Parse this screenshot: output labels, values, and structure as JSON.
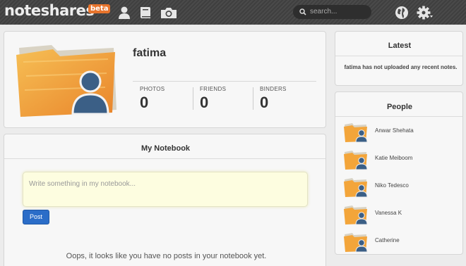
{
  "header": {
    "logo_text": "noteshares",
    "beta_label": "beta",
    "search_placeholder": "search...",
    "icons": [
      "user-icon",
      "book-icon",
      "camera-icon",
      "globe-icon",
      "gear-icon"
    ]
  },
  "profile": {
    "username": "fatima",
    "stats": [
      {
        "label": "PHOTOS",
        "value": "0"
      },
      {
        "label": "FRIENDS",
        "value": "0"
      },
      {
        "label": "BINDERS",
        "value": "0"
      }
    ]
  },
  "notebook": {
    "title": "My Notebook",
    "placeholder": "Write something in my notebook...",
    "post_label": "Post",
    "empty_message": "Oops, it looks like you have no posts in your notebook yet."
  },
  "latest": {
    "title": "Latest",
    "message": "fatima has not uploaded any recent notes."
  },
  "people": {
    "title": "People",
    "items": [
      {
        "name": "Anwar Shehata"
      },
      {
        "name": "Katie Meiboom"
      },
      {
        "name": "Niko Tedesco"
      },
      {
        "name": "Vanessa K"
      },
      {
        "name": "Catherine"
      }
    ]
  },
  "colors": {
    "accent": "#2b6dc8",
    "beta_badge": "#e8742c",
    "folder_orange": "#f3a53a",
    "avatar_blue": "#3b5f86"
  }
}
